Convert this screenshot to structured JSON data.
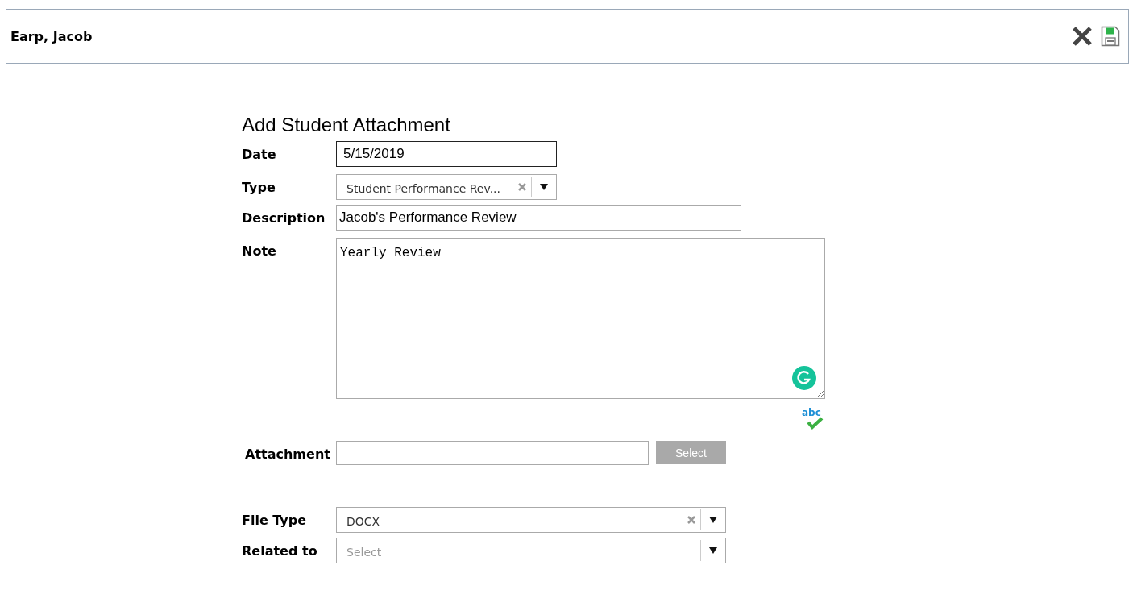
{
  "header": {
    "title": "Earp, Jacob"
  },
  "form": {
    "title": "Add Student Attachment",
    "fields": [
      {
        "kind": "text",
        "label": "Date",
        "value": "5/15/2019"
      },
      {
        "kind": "select",
        "label": "Type",
        "value": "Student Performance Rev...",
        "clearable": true
      },
      {
        "kind": "text",
        "label": "Description",
        "value": "Jacob's Performance Review"
      },
      {
        "kind": "textarea",
        "label": "Note",
        "value": "Yearly Review",
        "spellcheck": "abc"
      },
      {
        "kind": "file",
        "label": "Attachment",
        "button": "Select"
      },
      {
        "kind": "select",
        "label": "File Type",
        "value": "DOCX",
        "clearable": true
      },
      {
        "kind": "select",
        "label": "Related to",
        "placeholder": "Select",
        "clearable": false
      }
    ]
  }
}
